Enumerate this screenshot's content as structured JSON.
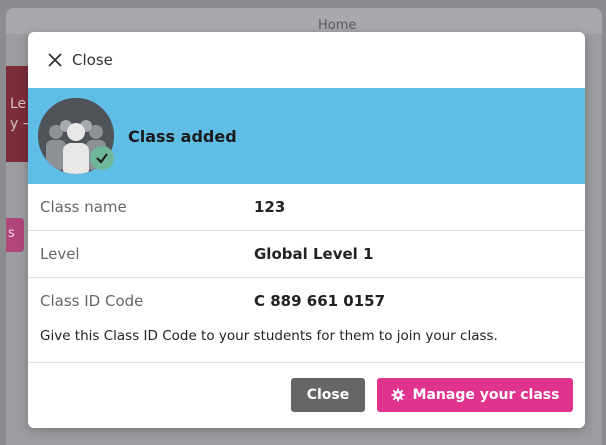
{
  "background": {
    "header_title": "Home",
    "side_card_text": "Le\ny →",
    "side_pink_text": "s"
  },
  "modal": {
    "close_link_label": "Close",
    "banner": {
      "title": "Class added"
    },
    "details": [
      {
        "label": "Class name",
        "value": "123"
      },
      {
        "label": "Level",
        "value": "Global Level 1"
      },
      {
        "label": "Class ID Code",
        "value": "C 889 661 0157"
      }
    ],
    "note": "Give this Class ID Code to your students for them to join your class.",
    "footer": {
      "close_button": "Close",
      "manage_button": "Manage your class"
    }
  },
  "colors": {
    "banner_blue": "#60bde6",
    "manage_pink": "#e0338e",
    "close_gray": "#666666",
    "check_green": "#6fb79a"
  },
  "icons": {
    "close": "close-icon",
    "avatar": "class-group-avatar-icon",
    "check": "check-icon",
    "gear": "gear-icon"
  }
}
